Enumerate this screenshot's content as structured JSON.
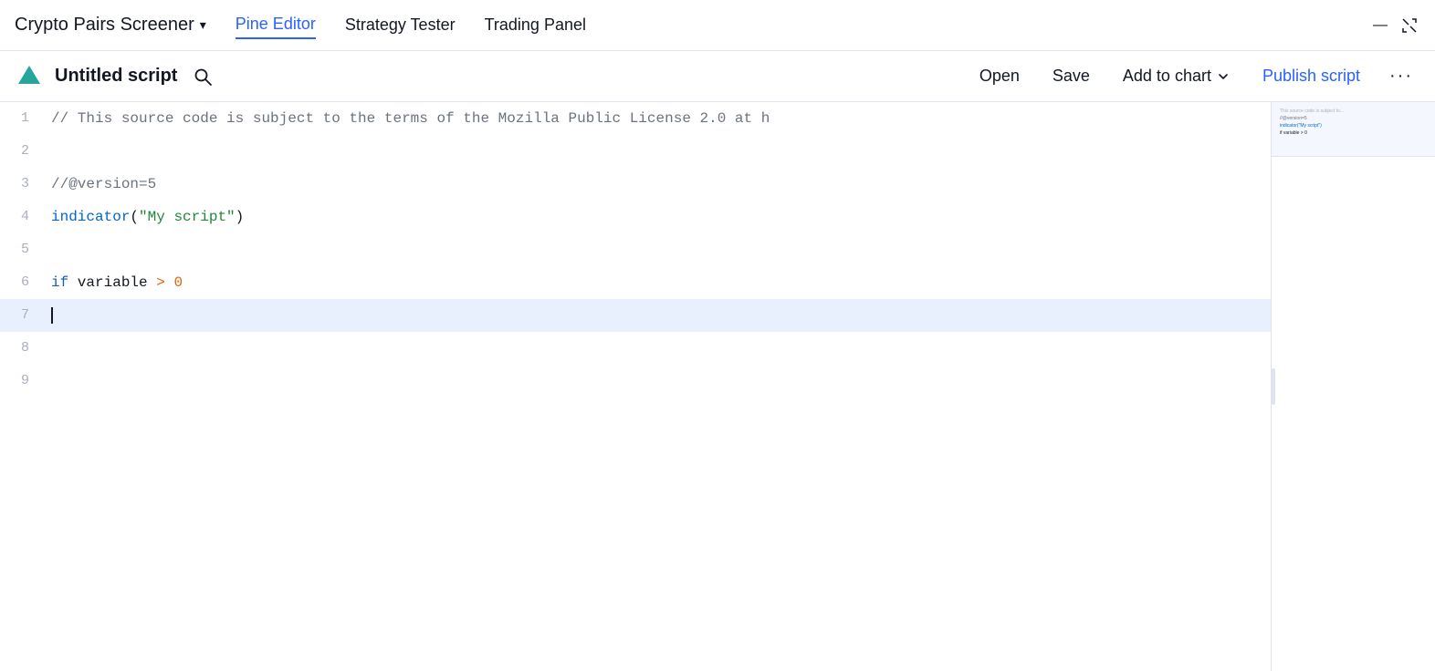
{
  "topNav": {
    "title": "Crypto Pairs Screener",
    "chevron": "▾",
    "tabs": [
      {
        "id": "pine-editor",
        "label": "Pine Editor",
        "active": true
      },
      {
        "id": "strategy-tester",
        "label": "Strategy Tester",
        "active": false
      },
      {
        "id": "trading-panel",
        "label": "Trading Panel",
        "active": false
      }
    ],
    "minimizeLabel": "—",
    "expandLabel": "⤢"
  },
  "toolbar": {
    "scriptTitle": "Untitled script",
    "openLabel": "Open",
    "saveLabel": "Save",
    "addToChartLabel": "Add to chart",
    "publishScriptLabel": "Publish script",
    "moreLabel": "···"
  },
  "editor": {
    "lines": [
      {
        "num": 1,
        "type": "comment",
        "text": "// This source code is subject to the terms of the Mozilla Public License 2.0 at h"
      },
      {
        "num": 2,
        "type": "empty",
        "text": ""
      },
      {
        "num": 3,
        "type": "version",
        "text": "//@version=5"
      },
      {
        "num": 4,
        "type": "indicator",
        "text": "indicator(\"My script\")"
      },
      {
        "num": 5,
        "type": "empty",
        "text": ""
      },
      {
        "num": 6,
        "type": "if",
        "text": "if variable > 0"
      },
      {
        "num": 7,
        "type": "cursor",
        "text": "",
        "highlighted": true
      },
      {
        "num": 8,
        "type": "empty",
        "text": ""
      },
      {
        "num": 9,
        "type": "empty",
        "text": ""
      }
    ]
  }
}
